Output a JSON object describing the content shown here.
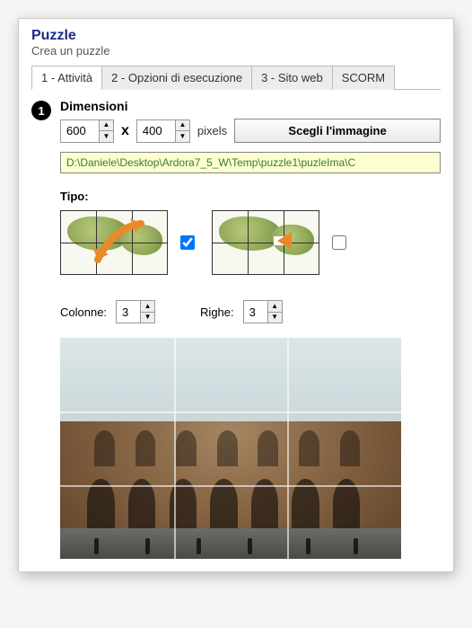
{
  "header": {
    "title": "Puzzle",
    "subtitle": "Crea un puzzle"
  },
  "tabs": {
    "t1": "1 - Attività",
    "t2": "2 - Opzioni di esecuzione",
    "t3": "3 - Sito web",
    "t4": "SCORM"
  },
  "section": {
    "badge": "1",
    "heading": "Dimensioni",
    "width": "600",
    "height": "400",
    "multiply": "x",
    "pixels_label": "pixels",
    "choose_button": "Scegli l'immagine",
    "path": "D:\\Daniele\\Desktop\\Ardora7_5_W\\Temp\\puzzle1\\puzleIma\\C"
  },
  "tipo": {
    "heading": "Tipo:",
    "opt_swap_checked": true,
    "opt_slide_checked": false
  },
  "grid": {
    "cols_label": "Colonne:",
    "cols_value": "3",
    "rows_label": "Righe:",
    "rows_value": "3"
  }
}
